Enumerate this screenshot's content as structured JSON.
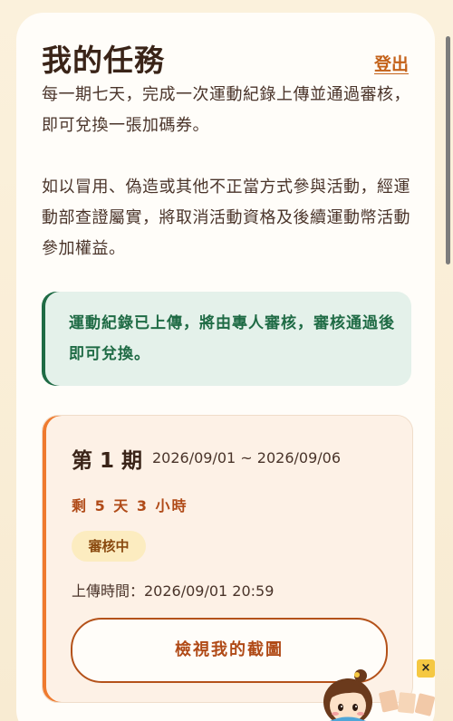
{
  "header": {
    "title": "我的任務",
    "logout_label": "登出"
  },
  "description": {
    "line1": "每一期七天，完成一次運動紀錄上傳並通過審核，即可兌換一張加碼券。",
    "line2": "如以冒用、偽造或其他不正當方式參與活動，經運動部查證屬實，將取消活動資格及後續運動幣活動參加權益。"
  },
  "notice": {
    "text": "運動紀錄已上傳，將由專人審核，審核通過後即可兌換。"
  },
  "period": {
    "label": "第 1 期",
    "dates": "2026/09/01 ~ 2026/09/06",
    "remaining": "剩 5 天 3 小時",
    "status_badge": "審核中",
    "upload_time": "上傳時間：2026/09/01 20:59",
    "view_button_label": "檢視我的截圖"
  },
  "floating_ad": {
    "close_label": "×",
    "icon": "mascot-girl-icon"
  },
  "colors": {
    "accent": "#c4621a",
    "notice_green": "#1f6b45",
    "period_orange": "#ef7a2e"
  }
}
